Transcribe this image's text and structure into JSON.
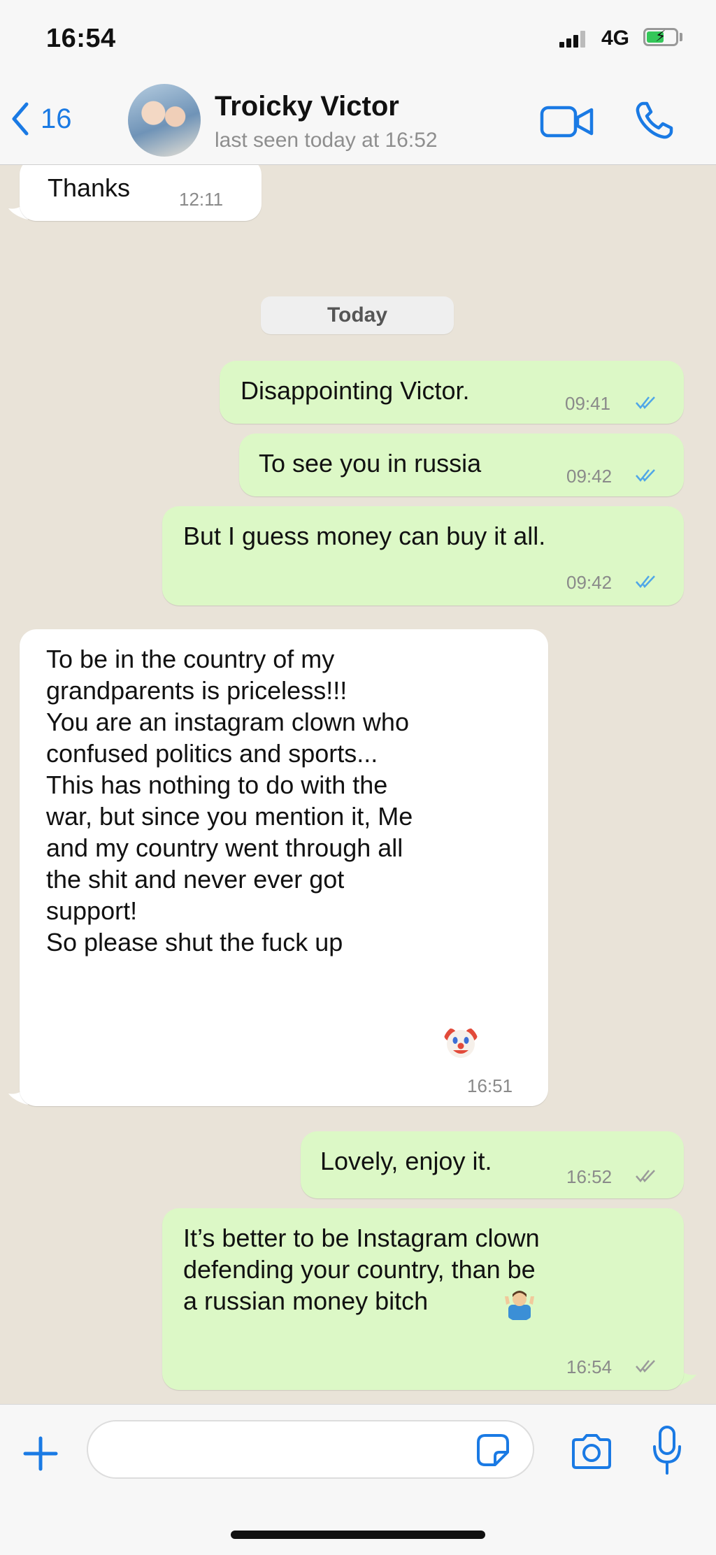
{
  "status_bar": {
    "time": "16:54",
    "network": "4G"
  },
  "header": {
    "back_count": "16",
    "contact_name": "Troicky Victor",
    "last_seen": "last seen today at 16:52"
  },
  "chat": {
    "date_label": "Today",
    "messages": [
      {
        "direction": "incoming",
        "text": "Thanks",
        "time": "12:11"
      },
      {
        "direction": "outgoing",
        "text": "Disappointing Victor.",
        "time": "09:41",
        "status": "read"
      },
      {
        "direction": "outgoing",
        "text": "To see you in russia",
        "time": "09:42",
        "status": "read"
      },
      {
        "direction": "outgoing",
        "text": "But I guess money can buy it all.",
        "time": "09:42",
        "status": "read"
      },
      {
        "direction": "incoming",
        "text": "To be in the country of my\ngrandparents is priceless!!!\nYou are an instagram clown who\nconfused politics and sports...\nThis has nothing to do with the\nwar, but since you mention it, Me\nand my country went through all\nthe shit and never ever got\nsupport!\nSo please shut the fuck up",
        "time": "16:51",
        "emoji": "clown-face"
      },
      {
        "direction": "outgoing",
        "text": "Lovely, enjoy it.",
        "time": "16:52",
        "status": "delivered"
      },
      {
        "direction": "outgoing",
        "text": "It’s better to be Instagram clown\ndefending your country, than be\na russian money bitch",
        "time": "16:54",
        "status": "delivered",
        "emoji": "person-shrugging"
      }
    ]
  },
  "colors": {
    "accent": "#1a7ae4",
    "outgoing_bubble": "#dcf8c6",
    "incoming_bubble": "#ffffff",
    "chat_background": "#e9e3d8",
    "read_tick": "#4fa6e8",
    "delivered_tick": "#9a9a9a"
  },
  "input_bar": {
    "text": ""
  }
}
